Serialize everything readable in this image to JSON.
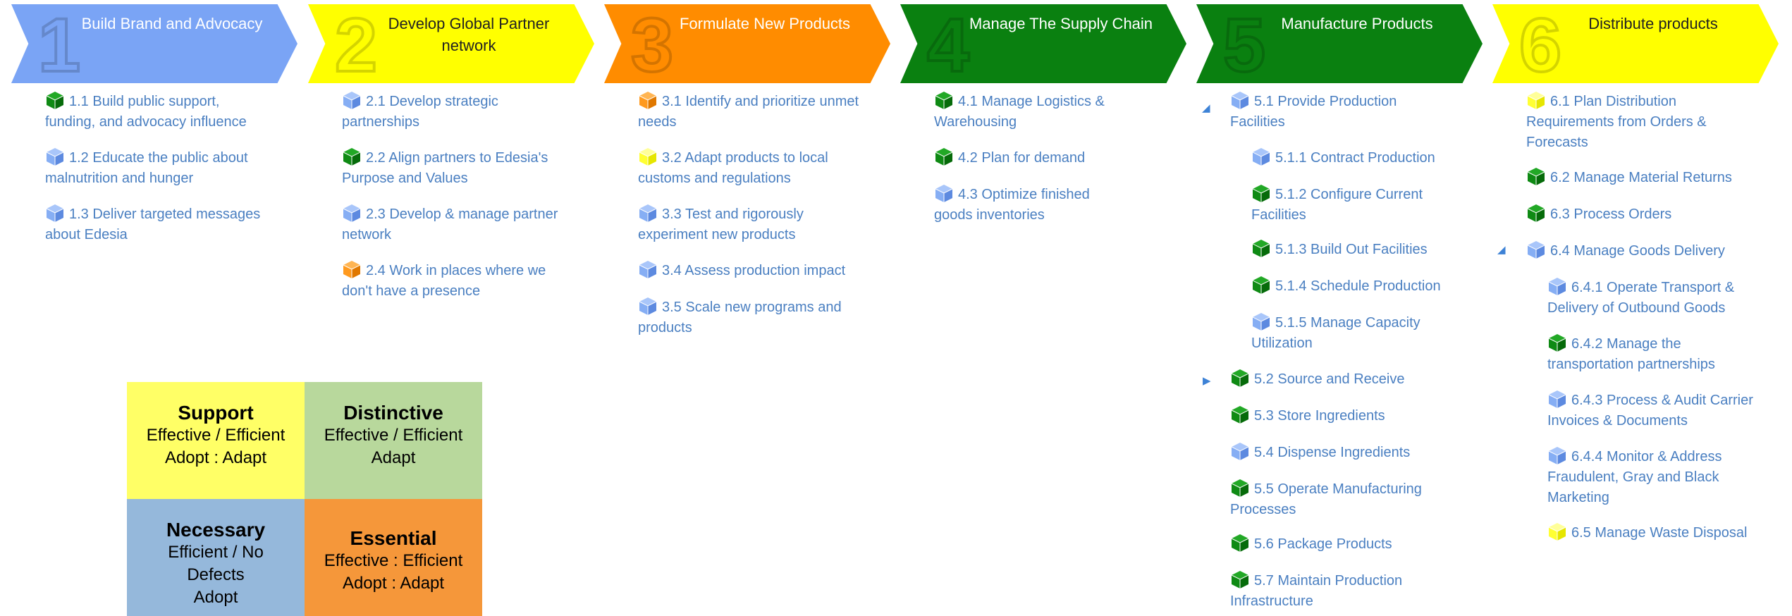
{
  "colors": {
    "blue": "#7aa4f5",
    "yellow": "#ffff00",
    "orange": "#ff8c00",
    "green": "#0a8010",
    "link": "#4a7fc1",
    "legend_yellow": "#ffff66",
    "legend_green": "#b8d89c",
    "legend_blue": "#95b8db",
    "legend_orange": "#f5973a"
  },
  "stages": [
    {
      "num": "1",
      "title": "Build Brand and Advocacy",
      "color": "blue"
    },
    {
      "num": "2",
      "title": "Develop Global Partner network",
      "color": "yellow"
    },
    {
      "num": "3",
      "title": "Formulate New Products",
      "color": "orange"
    },
    {
      "num": "4",
      "title": "Manage The Supply Chain",
      "color": "green"
    },
    {
      "num": "5",
      "title": "Manufacture Products",
      "color": "green"
    },
    {
      "num": "6",
      "title": "Distribute products",
      "color": "yellow"
    }
  ],
  "columns": [
    {
      "items": [
        {
          "label": "1.1 Build public support, funding, and advocacy influence",
          "icon": "green-cube-icon"
        },
        {
          "label": "1.2 Educate the public about malnutrition and hunger",
          "icon": "blue-cube-icon"
        },
        {
          "label": "1.3 Deliver targeted messages about Edesia",
          "icon": "blue-cube-icon"
        }
      ]
    },
    {
      "items": [
        {
          "label": "2.1 Develop strategic partnerships",
          "icon": "blue-cube-icon"
        },
        {
          "label": "2.2 Align partners to Edesia's Purpose and Values",
          "icon": "green-cube-icon"
        },
        {
          "label": "2.3 Develop & manage partner network",
          "icon": "blue-cube-icon"
        },
        {
          "label": "2.4 Work in places where we don't have a presence",
          "icon": "orange-cube-icon"
        }
      ]
    },
    {
      "items": [
        {
          "label": "3.1 Identify and prioritize unmet needs",
          "icon": "orange-cube-icon"
        },
        {
          "label": "3.2 Adapt products to local customs and regulations",
          "icon": "yellow-cube-icon"
        },
        {
          "label": "3.3 Test and rigorously experiment new products",
          "icon": "blue-cube-icon"
        },
        {
          "label": "3.4 Assess production impact",
          "icon": "blue-cube-icon"
        },
        {
          "label": "3.5 Scale new programs and products",
          "icon": "blue-cube-icon"
        }
      ]
    },
    {
      "items": [
        {
          "label": "4.1 Manage Logistics & Warehousing",
          "icon": "green-cube-icon"
        },
        {
          "label": "4.2 Plan for demand",
          "icon": "green-cube-icon"
        },
        {
          "label": "4.3 Optimize finished goods inventories",
          "icon": "blue-cube-icon"
        }
      ]
    },
    {
      "items": [
        {
          "label": "5.1 Provide Production Facilities",
          "icon": "blue-cube-icon"
        },
        {
          "label": "5.1.1 Contract Production",
          "icon": "blue-cube-icon"
        },
        {
          "label": "5.1.2 Configure Current Facilities",
          "icon": "green-cube-icon"
        },
        {
          "label": "5.1.3 Build Out Facilities",
          "icon": "green-cube-icon"
        },
        {
          "label": "5.1.4 Schedule Production",
          "icon": "green-cube-icon"
        },
        {
          "label": "5.1.5 Manage Capacity Utilization",
          "icon": "blue-cube-icon"
        },
        {
          "label": "5.2 Source and Receive",
          "icon": "green-cube-icon"
        },
        {
          "label": "5.3 Store Ingredients",
          "icon": "green-cube-icon"
        },
        {
          "label": "5.4 Dispense Ingredients",
          "icon": "blue-cube-icon"
        },
        {
          "label": "5.5 Operate Manufacturing Processes",
          "icon": "green-cube-icon"
        },
        {
          "label": "5.6 Package Products",
          "icon": "green-cube-icon"
        },
        {
          "label": "5.7 Maintain Production Infrastructure",
          "icon": "green-cube-icon"
        }
      ]
    },
    {
      "items": [
        {
          "label": "6.1 Plan Distribution Requirements from Orders & Forecasts",
          "icon": "yellow-cube-icon"
        },
        {
          "label": "6.2 Manage Material Returns",
          "icon": "green-cube-icon"
        },
        {
          "label": "6.3 Process Orders",
          "icon": "green-cube-icon"
        },
        {
          "label": "6.4 Manage Goods Delivery",
          "icon": "blue-cube-icon"
        },
        {
          "label": "6.4.1 Operate Transport & Delivery of Outbound Goods",
          "icon": "blue-cube-icon"
        },
        {
          "label": "6.4.2 Manage the transportation partnerships",
          "icon": "green-cube-icon"
        },
        {
          "label": "6.4.3 Process & Audit Carrier Invoices & Documents",
          "icon": "blue-cube-icon"
        },
        {
          "label": "6.4.4 Monitor & Address Fraudulent, Gray and Black Marketing",
          "icon": "blue-cube-icon"
        },
        {
          "label": "6.5 Manage Waste Disposal",
          "icon": "yellow-cube-icon"
        }
      ]
    }
  ],
  "carets": {
    "expanded": "◢",
    "collapsed": "▶"
  },
  "legend": [
    {
      "heading": "Support",
      "lines": [
        "Effective / Efficient",
        "Adopt : Adapt"
      ],
      "color": "legend_yellow"
    },
    {
      "heading": "Distinctive",
      "lines": [
        "Effective / Efficient",
        "Adapt"
      ],
      "color": "legend_green"
    },
    {
      "heading": "Necessary",
      "lines": [
        "Efficient / No",
        "Defects",
        "Adopt"
      ],
      "color": "legend_blue"
    },
    {
      "heading": "Essential",
      "lines": [
        "Effective : Efficient",
        "Adopt : Adapt"
      ],
      "color": "legend_orange"
    }
  ]
}
